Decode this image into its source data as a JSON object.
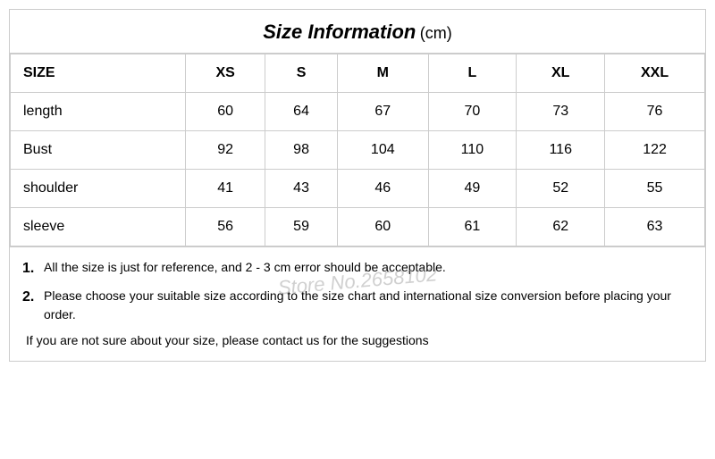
{
  "title": {
    "main": "Size Information",
    "unit": "(cm)"
  },
  "table": {
    "headers": [
      "SIZE",
      "XS",
      "S",
      "M",
      "L",
      "XL",
      "XXL"
    ],
    "rows": [
      {
        "label": "length",
        "values": [
          "60",
          "64",
          "67",
          "70",
          "73",
          "76"
        ]
      },
      {
        "label": "Bust",
        "values": [
          "92",
          "98",
          "104",
          "110",
          "116",
          "122"
        ]
      },
      {
        "label": "shoulder",
        "values": [
          "41",
          "43",
          "46",
          "49",
          "52",
          "55"
        ]
      },
      {
        "label": "sleeve",
        "values": [
          "56",
          "59",
          "60",
          "61",
          "62",
          "63"
        ]
      }
    ]
  },
  "notes": [
    {
      "num": "1.",
      "text": "All the size is just for reference, and 2 - 3 cm error should be acceptable."
    },
    {
      "num": "2.",
      "text": "Please choose your suitable size according to the size chart and international size conversion before placing your order."
    }
  ],
  "extra_note": "If you are not sure about your size, please contact us for the suggestions",
  "watermark": "Store No.2658102"
}
